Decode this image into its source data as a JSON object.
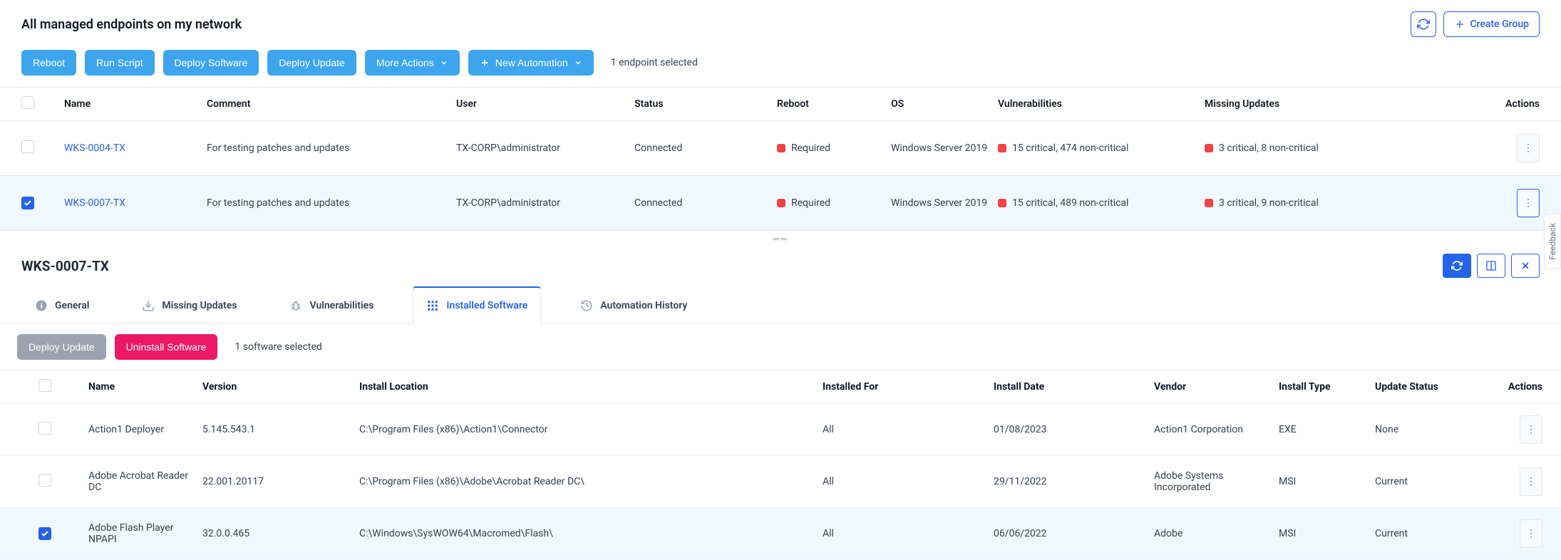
{
  "header": {
    "title": "All managed endpoints on my network",
    "create_group": "Create Group"
  },
  "toolbar": {
    "reboot": "Reboot",
    "run_script": "Run Script",
    "deploy_software": "Deploy Software",
    "deploy_update": "Deploy Update",
    "more_actions": "More Actions",
    "new_automation": "New Automation",
    "selected_text": "1 endpoint selected"
  },
  "endpoints": {
    "columns": {
      "name": "Name",
      "comment": "Comment",
      "user": "User",
      "status": "Status",
      "reboot": "Reboot",
      "os": "OS",
      "vulnerabilities": "Vulnerabilities",
      "missing_updates": "Missing Updates",
      "actions": "Actions"
    },
    "rows": [
      {
        "name": "WKS-0004-TX",
        "comment": "For testing patches and updates",
        "user": "TX-CORP\\administrator",
        "status": "Connected",
        "reboot": "Required",
        "os": "Windows Server 2019",
        "vuln": "15 critical,  474 non-critical",
        "updates": "3 critical,  8 non-critical",
        "checked": false
      },
      {
        "name": "WKS-0007-TX",
        "comment": "For testing patches and updates",
        "user": "TX-CORP\\administrator",
        "status": "Connected",
        "reboot": "Required",
        "os": "Windows Server 2019",
        "vuln": "15 critical,  489 non-critical",
        "updates": "3 critical,  9 non-critical",
        "checked": true
      }
    ]
  },
  "detail": {
    "title": "WKS-0007-TX",
    "tabs": {
      "general": "General",
      "missing_updates": "Missing Updates",
      "vulnerabilities": "Vulnerabilities",
      "installed_software": "Installed Software",
      "automation_history": "Automation History"
    },
    "sw_toolbar": {
      "deploy_update": "Deploy Update",
      "uninstall_software": "Uninstall Software",
      "selected": "1 software selected"
    },
    "sw_columns": {
      "name": "Name",
      "version": "Version",
      "location": "Install Location",
      "installed_for": "Installed For",
      "install_date": "Install Date",
      "vendor": "Vendor",
      "install_type": "Install Type",
      "update_status": "Update Status",
      "actions": "Actions"
    },
    "sw_rows": [
      {
        "name": "Action1 Deployer",
        "version": "5.145.543.1",
        "location": "C:\\Program Files (x86)\\Action1\\Connector",
        "installed_for": "All",
        "install_date": "01/08/2023",
        "vendor": "Action1 Corporation",
        "install_type": "EXE",
        "update_status": "None",
        "checked": false
      },
      {
        "name": "Adobe Acrobat Reader DC",
        "version": "22.001.20117",
        "location": "C:\\Program Files (x86)\\Adobe\\Acrobat Reader DC\\",
        "installed_for": "All",
        "install_date": "29/11/2022",
        "vendor": "Adobe Systems Incorporated",
        "install_type": "MSI",
        "update_status": "Current",
        "checked": false
      },
      {
        "name": "Adobe Flash Player NPAPI",
        "version": "32.0.0.465",
        "location": "C:\\Windows\\SysWOW64\\Macromed\\Flash\\",
        "installed_for": "All",
        "install_date": "06/06/2022",
        "vendor": "Adobe",
        "install_type": "MSI",
        "update_status": "Current",
        "checked": true
      }
    ]
  },
  "feedback": "Feedback"
}
